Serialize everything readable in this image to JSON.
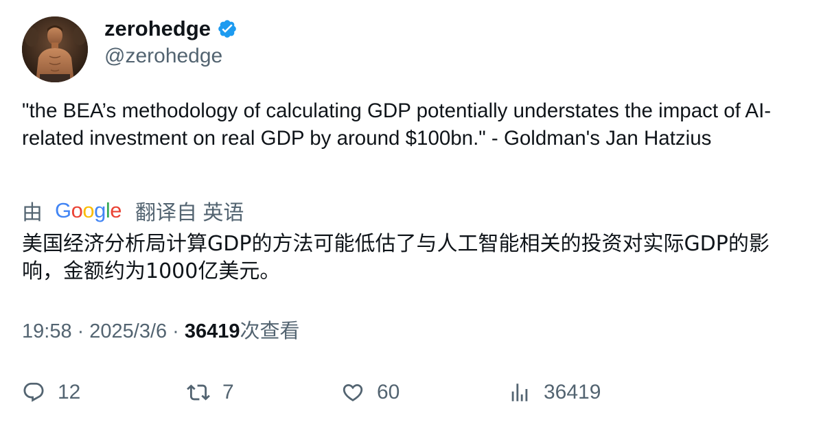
{
  "author": {
    "display_name": "zerohedge",
    "handle": "@zerohedge",
    "verified": true,
    "avatar_icon": "avatar-photo"
  },
  "tweet": {
    "text": "\"the BEA’s methodology of calculating GDP potentially understates the impact of AI-related investment on real GDP by around $100bn.\" - Goldman's Jan Hatzius"
  },
  "translation": {
    "prefix": "由",
    "provider": "Google",
    "suffix": "翻译自 英语",
    "text": "美国经济分析局计算GDP的方法可能低估了与人工智能相关的投资对实际GDP的影响，金额约为1000亿美元。"
  },
  "meta": {
    "time": "19:58",
    "separator": "·",
    "date": "2025/3/6",
    "views_count": "36419",
    "views_label": "次查看"
  },
  "actions": {
    "replies": "12",
    "retweets": "7",
    "likes": "60",
    "views": "36419"
  },
  "colors": {
    "text_primary": "#0f1419",
    "text_secondary": "#536471",
    "verified_blue": "#1d9bf0"
  }
}
